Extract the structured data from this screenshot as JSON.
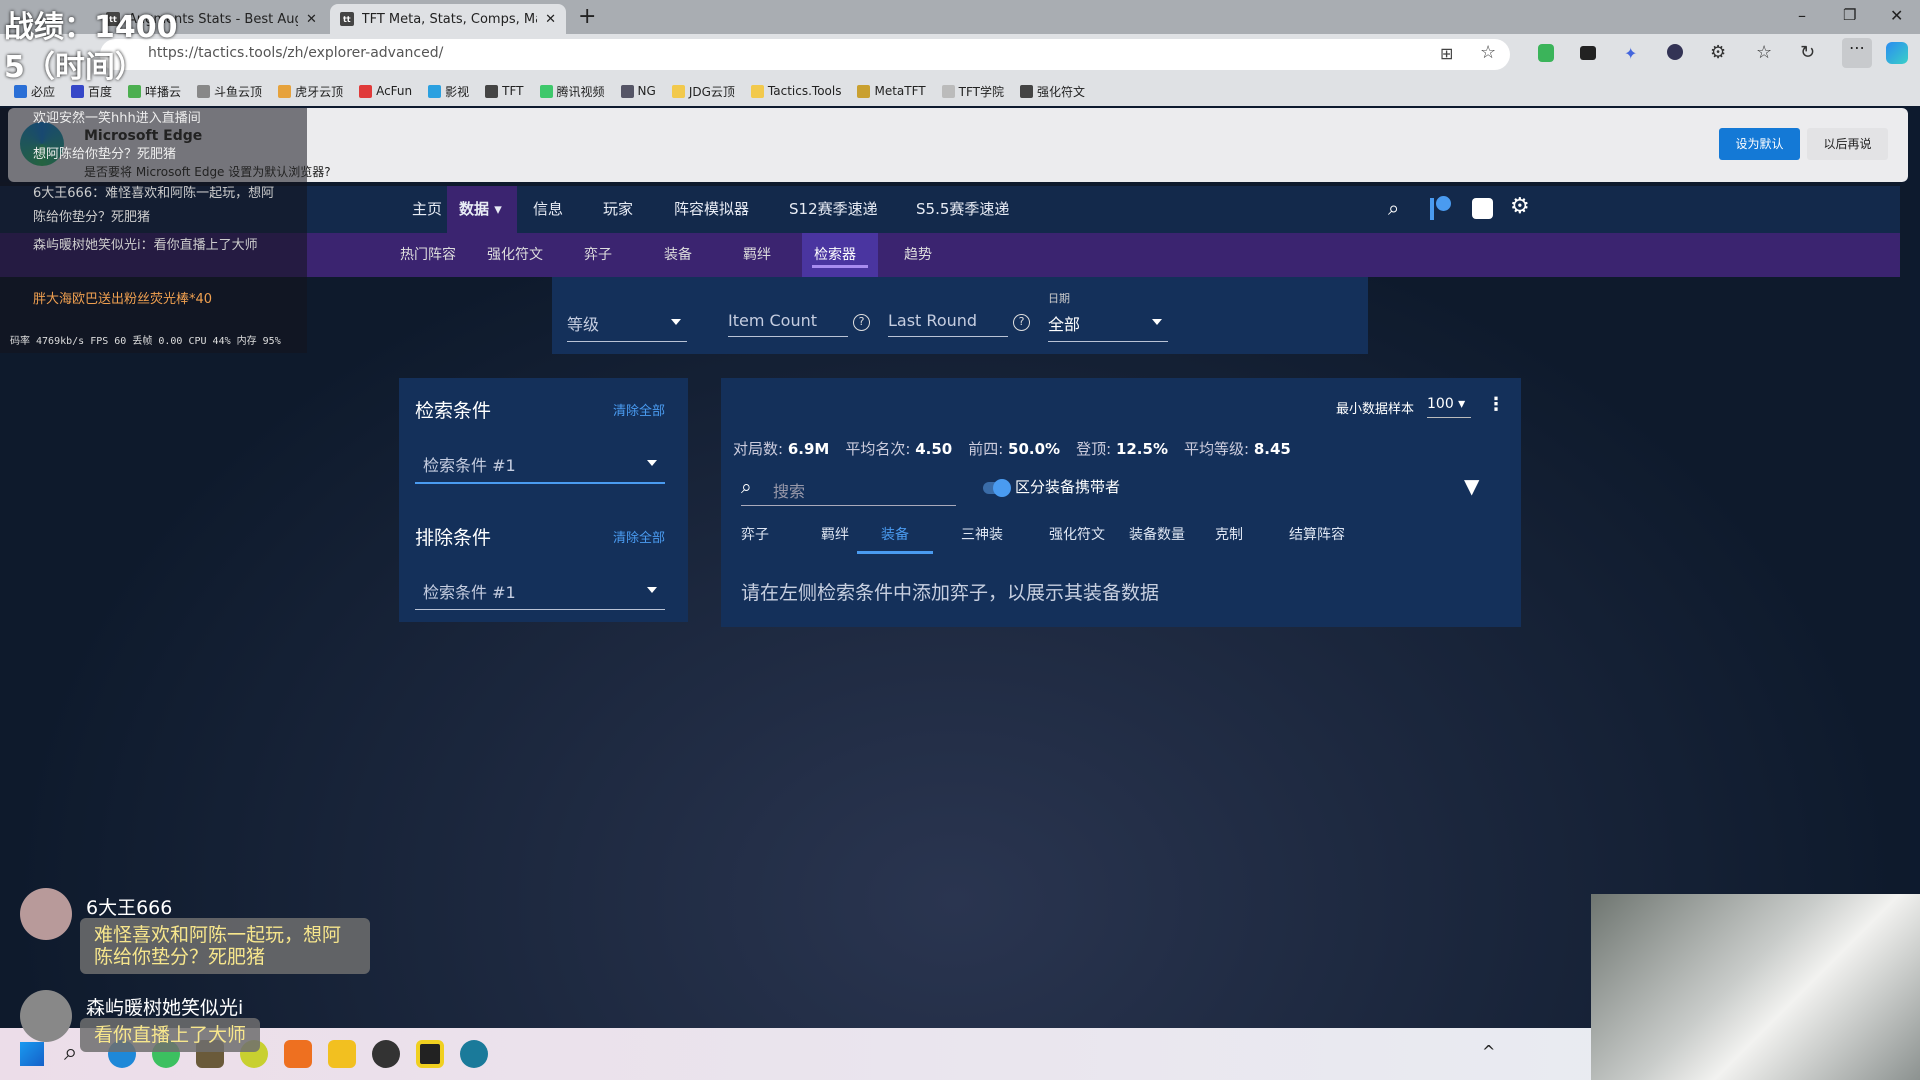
{
  "browser": {
    "tabs": [
      {
        "label": "Augments Stats - Best Augme"
      },
      {
        "label": "TFT Meta, Stats, Comps, Match Hi"
      }
    ],
    "url": "https://tactics.tools/zh/explorer-advanced/",
    "bookmarks": [
      {
        "label": "必应",
        "color": "#2a6fd6"
      },
      {
        "label": "百度",
        "color": "#3547c8"
      },
      {
        "label": "咩播云",
        "color": "#4caf50"
      },
      {
        "label": "斗鱼云顶",
        "color": "#888"
      },
      {
        "label": "虎牙云顶",
        "color": "#e6a23c"
      },
      {
        "label": "AcFun",
        "color": "#e03a3a"
      },
      {
        "label": "影视",
        "color": "#2aa0e0"
      },
      {
        "label": "TFT",
        "color": "#444"
      },
      {
        "label": "腾讯视频",
        "color": "#3ec86b"
      },
      {
        "label": "NG",
        "color": "#556"
      },
      {
        "label": "JDG云顶",
        "color": "#f2c94c"
      },
      {
        "label": "Tactics.Tools",
        "color": "#f2c94c"
      },
      {
        "label": "MetaTFT",
        "color": "#c9a030"
      },
      {
        "label": "TFT学院",
        "color": "#bbb"
      },
      {
        "label": "强化符文",
        "color": "#444"
      }
    ],
    "notice": {
      "title": "Microsoft Edge",
      "text": "是否要将 Microsoft Edge 设置为默认浏览器?",
      "primary": "设为默认",
      "secondary": "以后再说"
    }
  },
  "site": {
    "nav": [
      {
        "label": "主页"
      },
      {
        "label": "数据 ▾",
        "active": true
      },
      {
        "label": "信息"
      },
      {
        "label": "玩家"
      },
      {
        "label": "阵容模拟器"
      },
      {
        "label": "S12赛季速递"
      },
      {
        "label": "S5.5赛季速递"
      }
    ],
    "subnav": [
      {
        "label": "热门阵容"
      },
      {
        "label": "强化符文"
      },
      {
        "label": "弈子"
      },
      {
        "label": "装备"
      },
      {
        "label": "羁绊"
      },
      {
        "label": "检索器",
        "active": true
      },
      {
        "label": "趋势"
      }
    ],
    "filters": {
      "level": "等级",
      "item_count": "Item Count",
      "last_round": "Last Round",
      "date_label": "日期",
      "date_value": "全部"
    },
    "include": {
      "title": "检索条件",
      "clear": "清除全部",
      "placeholder": "检索条件 #1"
    },
    "exclude": {
      "title": "排除条件",
      "clear": "清除全部",
      "placeholder": "检索条件 #1"
    },
    "results": {
      "min_sample_label": "最小数据样本",
      "min_sample_value": "100",
      "stats": [
        {
          "label": "对局数:",
          "value": "6.9M"
        },
        {
          "label": "平均名次:",
          "value": "4.50"
        },
        {
          "label": "前四:",
          "value": "50.0%"
        },
        {
          "label": "登顶:",
          "value": "12.5%"
        },
        {
          "label": "平均等级:",
          "value": "8.45"
        }
      ],
      "search_placeholder": "搜索",
      "toggle_label": "区分装备携带者",
      "toggle_on": true,
      "tabs": [
        {
          "label": "弈子"
        },
        {
          "label": "羁绊"
        },
        {
          "label": "装备",
          "active": true
        },
        {
          "label": "三神装"
        },
        {
          "label": "强化符文"
        },
        {
          "label": "装备数量"
        },
        {
          "label": "克制"
        },
        {
          "label": "结算阵容"
        }
      ],
      "empty_message": "请在左侧检索条件中添加弈子，以展示其装备数据"
    },
    "accent": "#4a9bf0"
  },
  "overlay": {
    "score": "战绩：1400",
    "time": "5（时间）",
    "stats_line": "码率 4769kb/s FPS 60 丢帧 0.00 CPU 44% 内存 95%",
    "chat": [
      {
        "text": "欢迎安然一笑hhh进入直播间"
      },
      {
        "text": "想阿陈给你垫分？死肥猪"
      },
      {
        "text": "6大王666：难怪喜欢和阿陈一起玩，想阿陈给你垫分？死肥猪"
      },
      {
        "text": "森屿暖树她笑似光i：看你直播上了大师"
      },
      {
        "text": "胖大海欧巴送出粉丝荧光棒*40"
      }
    ],
    "bubbles": [
      {
        "user": "6大王666",
        "text": "难怪喜欢和阿陈一起玩，想阿陈给你垫分？死肥猪"
      },
      {
        "user": "森屿暖树她笑似光i",
        "text": "看你直播上了大师"
      }
    ]
  }
}
